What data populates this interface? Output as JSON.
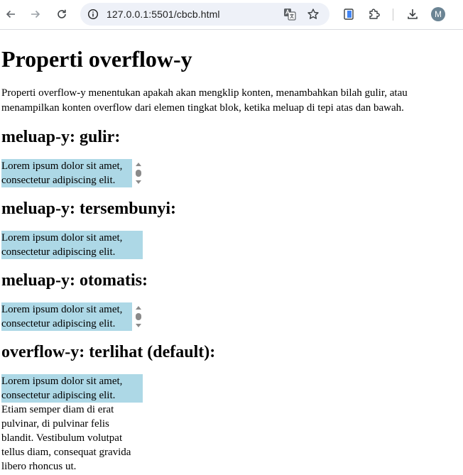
{
  "browser": {
    "url": "127.0.0.1:5501/cbcb.html",
    "avatar_initial": "M",
    "icons": [
      "back-icon",
      "forward-icon",
      "reload-icon",
      "site-info-icon",
      "translate-icon",
      "bookmark-star-icon",
      "extension-page-icon",
      "extensions-puzzle-icon",
      "download-icon"
    ]
  },
  "page": {
    "title": "Properti overflow-y",
    "description": "Properti overflow-y menentukan apakah akan mengklip konten, menambahkan bilah gulir, atau menampilkan konten overflow dari elemen tingkat blok, ketika meluap di tepi atas dan bawah.",
    "sections": [
      {
        "heading": "meluap-y: gulir:",
        "text": "Lorem ipsum dolor sit amet, consectetur adipiscing elit."
      },
      {
        "heading": "meluap-y: tersembunyi:",
        "text": "Lorem ipsum dolor sit amet, consectetur adipiscing elit. Etiam"
      },
      {
        "heading": "meluap-y: otomatis:",
        "text": "Lorem ipsum dolor sit amet, consectetur adipiscing elit."
      },
      {
        "heading": "overflow-y: terlihat (default):",
        "text": "Lorem ipsum dolor sit amet, consectetur adipiscing elit. Etiam semper diam di erat pulvinar, di pulvinar felis blandit. Vestibulum volutpat tellus diam, consequat gravida libero rhoncus ut."
      }
    ]
  },
  "colors": {
    "demo_background": "#add8e6",
    "scrollbar_arrow": "#8a8a8a"
  }
}
